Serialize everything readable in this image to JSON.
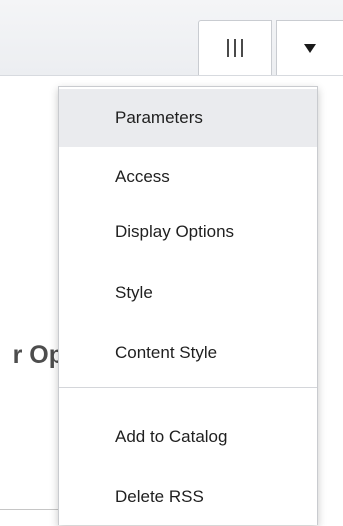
{
  "toolbar": {
    "columns_icon": "column-bars-icon",
    "dropdown_icon": "caret-down-icon"
  },
  "background": {
    "partial_text": "r Op"
  },
  "menu": {
    "items": [
      {
        "label": "Parameters",
        "active": true
      },
      {
        "label": "Access"
      },
      {
        "label": "Display Options"
      },
      {
        "label": "Style"
      },
      {
        "label": "Content Style"
      },
      {
        "label": "Add to Catalog"
      },
      {
        "label": "Delete RSS"
      }
    ]
  },
  "colors": {
    "active_item_bg": "#eaebee",
    "toolbar_bg": "#eceef1",
    "menu_border": "#c9cbcf"
  }
}
